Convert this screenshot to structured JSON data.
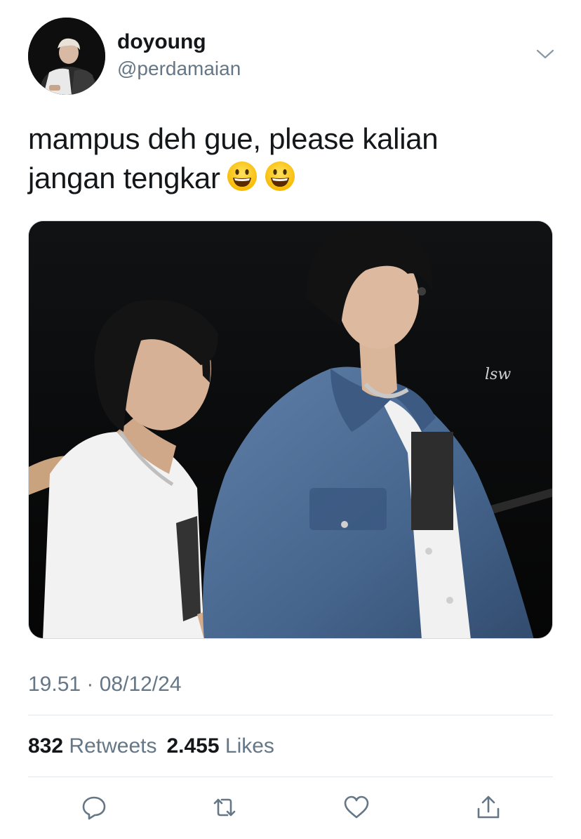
{
  "tweet": {
    "display_name": "doyoung",
    "handle": "@perdamaian",
    "text": "mampus deh gue, please kalian jangan tengkar",
    "emoji": [
      "grinning-face",
      "grinning-face"
    ],
    "timestamp": "19.51 · 08/12/24",
    "retweets_count": "832",
    "retweets_label": "Retweets",
    "likes_count": "2.455",
    "likes_label": "Likes"
  },
  "icons": {
    "more": "chevron-down-icon",
    "reply": "reply-icon",
    "retweet": "retweet-icon",
    "like": "heart-icon",
    "share": "share-icon"
  },
  "colors": {
    "text_primary": "#14171a",
    "text_secondary": "#657786",
    "icon": "#657786",
    "divider": "#e1e8ed"
  }
}
